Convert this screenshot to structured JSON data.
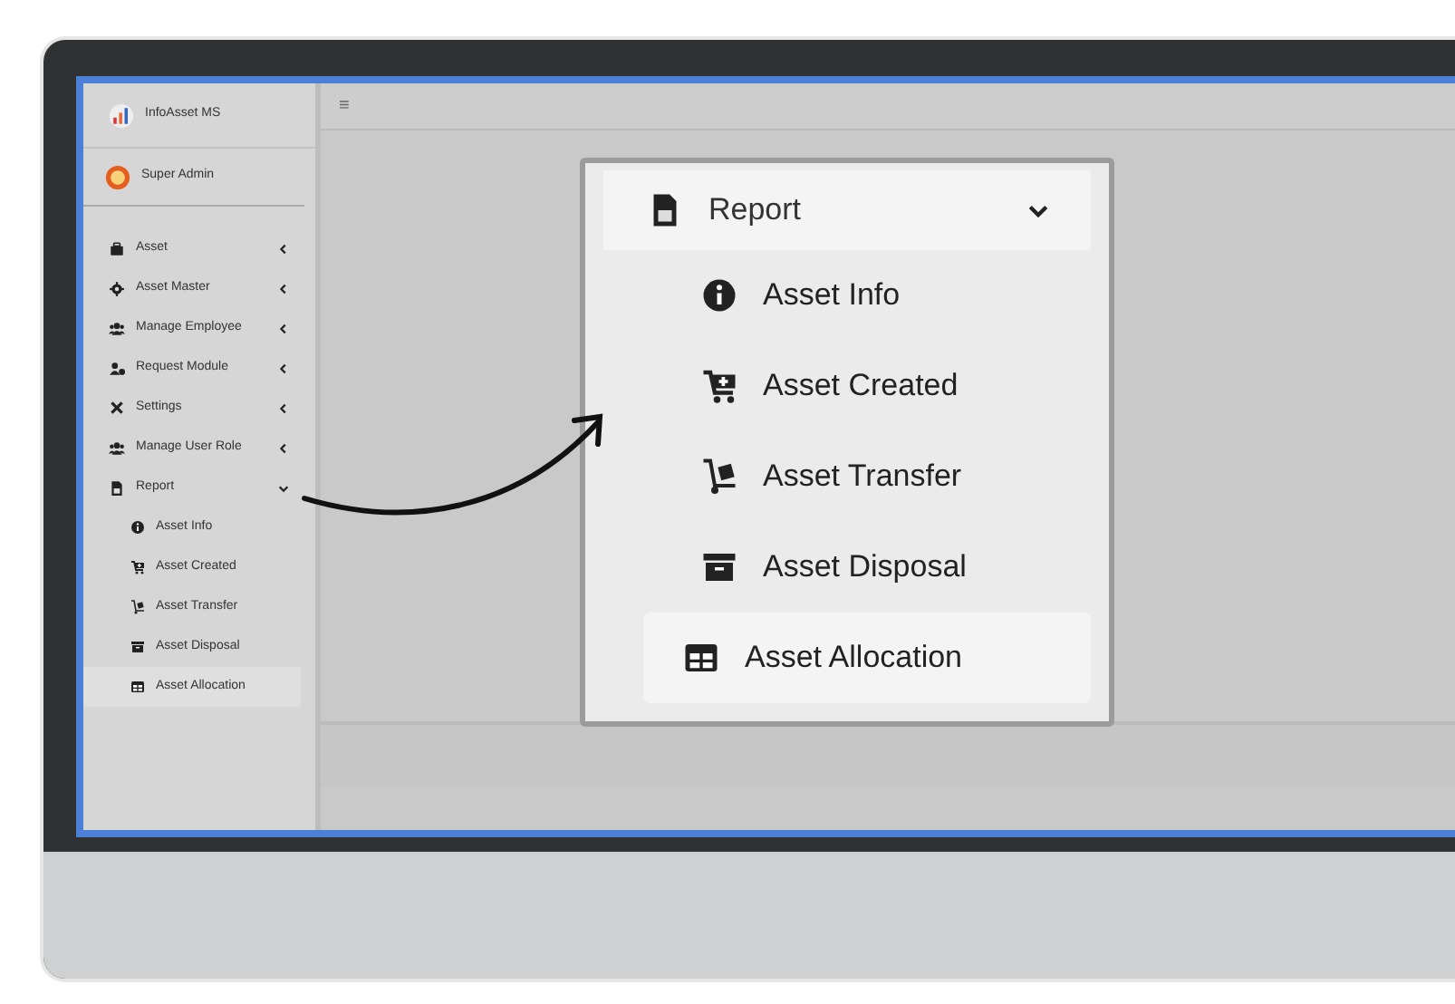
{
  "sidebar": {
    "brand": "InfoAsset MS",
    "user": "Super Admin",
    "items": [
      {
        "label": "Asset",
        "expanded": false
      },
      {
        "label": "Asset Master",
        "expanded": false
      },
      {
        "label": "Manage Employee",
        "expanded": false
      },
      {
        "label": "Request Module",
        "expanded": false
      },
      {
        "label": "Settings",
        "expanded": false
      },
      {
        "label": "Manage User Role",
        "expanded": false
      },
      {
        "label": "Report",
        "expanded": true,
        "children": [
          {
            "label": "Asset Info",
            "selected": false
          },
          {
            "label": "Asset Created",
            "selected": false
          },
          {
            "label": "Asset Transfer",
            "selected": false
          },
          {
            "label": "Asset Disposal",
            "selected": false
          },
          {
            "label": "Asset Allocation",
            "selected": true
          }
        ]
      }
    ]
  },
  "topbar": {
    "menu_toggle": "≡"
  },
  "callout": {
    "header": "Report",
    "expanded": true,
    "items": [
      {
        "label": "Asset Info",
        "selected": false
      },
      {
        "label": "Asset Created",
        "selected": false
      },
      {
        "label": "Asset Transfer",
        "selected": false
      },
      {
        "label": "Asset Disposal",
        "selected": false
      },
      {
        "label": "Asset Allocation",
        "selected": true
      }
    ]
  }
}
